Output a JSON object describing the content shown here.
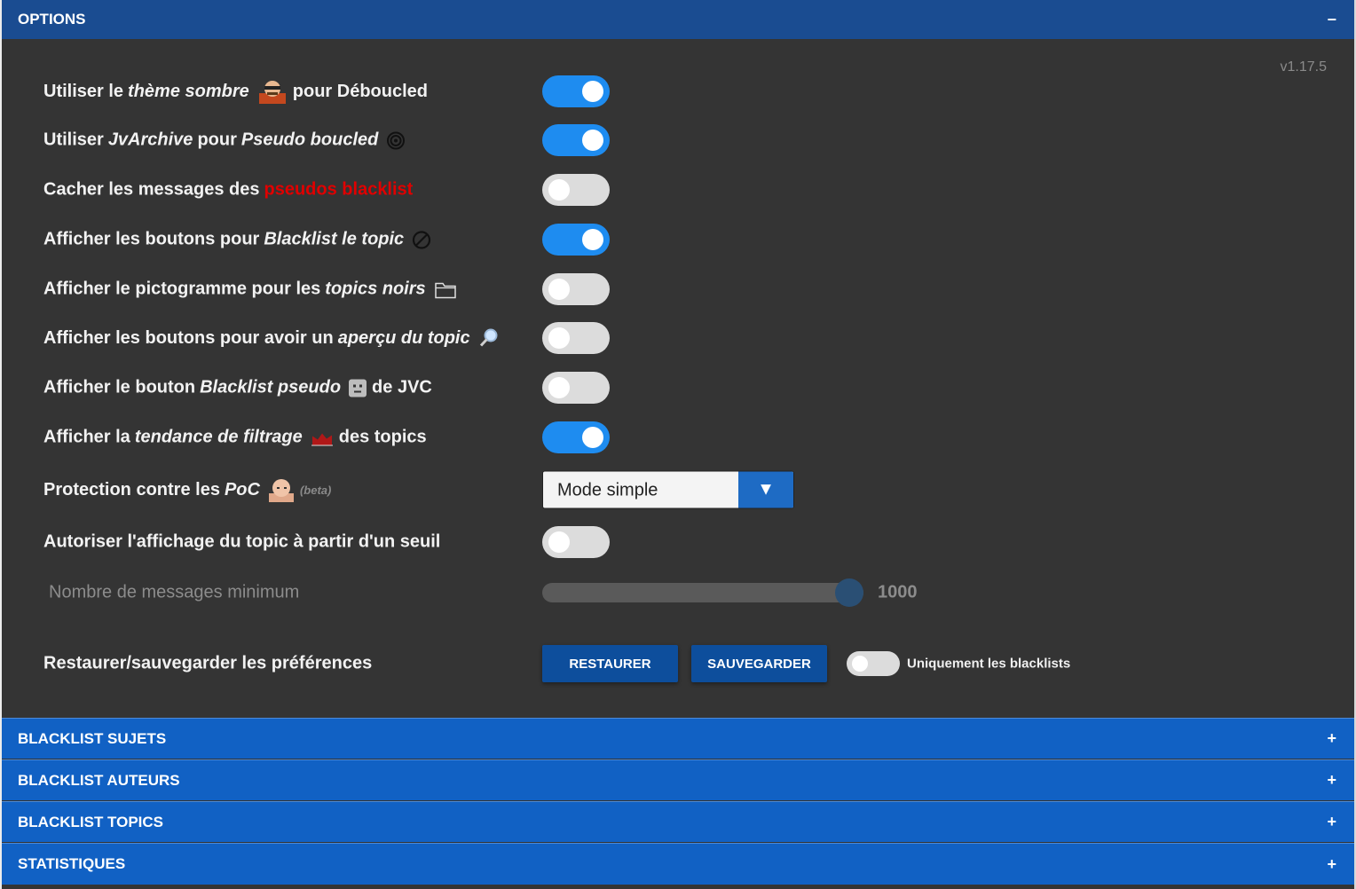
{
  "options_header": {
    "title": "OPTIONS",
    "sign": "−"
  },
  "version": "v1.17.5",
  "rows": [
    {
      "pre": "Utiliser le",
      "em": "thème sombre",
      "post": "pour Déboucled",
      "icon": "avatar-icon",
      "toggle": true
    },
    {
      "pre": "Utiliser",
      "em": "JvArchive",
      "mid": "pour",
      "em2": "Pseudo boucled",
      "icon": "spiral-icon",
      "toggle": true
    },
    {
      "pre": "Cacher les messages des",
      "red": "pseudos blacklist",
      "toggle": false
    },
    {
      "pre": "Afficher les boutons pour",
      "em": "Blacklist le topic",
      "icon": "block-icon",
      "toggle": true
    },
    {
      "pre": "Afficher le pictogramme pour les",
      "em": "topics noirs",
      "icon": "folder-icon",
      "toggle": false
    },
    {
      "pre": "Afficher les boutons pour avoir un",
      "em": "aperçu du topic",
      "icon": "magnifier-icon",
      "toggle": false
    },
    {
      "pre": "Afficher le bouton",
      "em": "Blacklist pseudo",
      "post": "de JVC",
      "icon": "sad-face-icon",
      "toggle": false
    },
    {
      "pre": "Afficher la",
      "em": "tendance de filtrage",
      "post": "des topics",
      "icon": "chart-icon",
      "toggle": true
    }
  ],
  "poc": {
    "pre": "Protection contre les",
    "em": "PoC",
    "beta": "(beta)",
    "select_value": "Mode simple",
    "arrow": "▼"
  },
  "threshold": {
    "label": "Autoriser l'affichage du topic à partir d'un seuil",
    "toggle": false
  },
  "min_messages": {
    "label": "Nombre de messages minimum",
    "value": "1000",
    "level": 0.95
  },
  "backup": {
    "label": "Restaurer/sauvegarder les préférences",
    "restore": "RESTAURER",
    "save": "SAUVEGARDER",
    "only_label": "Uniquement les blacklists",
    "only_toggle": false
  },
  "sections": [
    {
      "title": "BLACKLIST SUJETS",
      "sign": "+"
    },
    {
      "title": "BLACKLIST AUTEURS",
      "sign": "+"
    },
    {
      "title": "BLACKLIST TOPICS",
      "sign": "+"
    },
    {
      "title": "STATISTIQUES",
      "sign": "+"
    }
  ],
  "colors": {
    "toggle_on": "#1e8cf0",
    "toggle_off": "#dcdcdc",
    "header": "#1161c4",
    "options_header": "#1a4c91",
    "red_text": "#e00000"
  }
}
